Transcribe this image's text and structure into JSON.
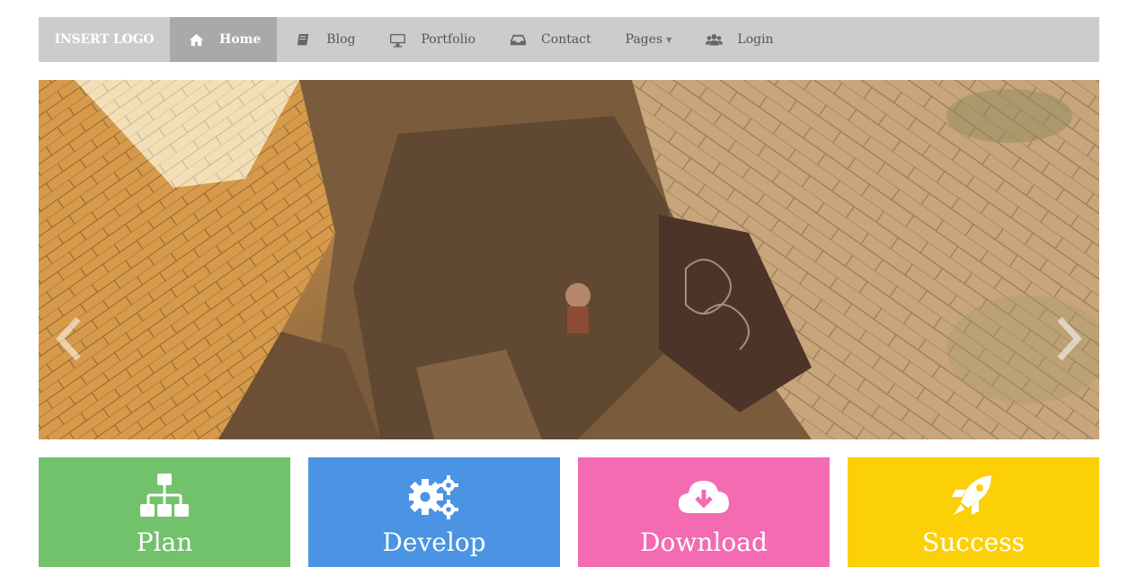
{
  "navbar": {
    "brand": "INSERT LOGO",
    "items": [
      {
        "label": "Home",
        "icon": "home-icon",
        "active": true
      },
      {
        "label": "Blog",
        "icon": "book-icon"
      },
      {
        "label": "Portfolio",
        "icon": "desktop-icon"
      },
      {
        "label": "Contact",
        "icon": "inbox-icon"
      },
      {
        "label": "Pages",
        "icon": "caret-down-icon"
      },
      {
        "label": "Login",
        "icon": "users-icon"
      }
    ]
  },
  "slider": {
    "image": "illustrated-stone-alley-scene",
    "prev_icon": "chevron-left-icon",
    "next_icon": "chevron-right-icon"
  },
  "tiles": [
    {
      "label": "Plan",
      "icon": "sitemap-icon",
      "color": "#72c16b"
    },
    {
      "label": "Develop",
      "icon": "gears-icon",
      "color": "#4a94e3"
    },
    {
      "label": "Download",
      "icon": "cloud-download-icon",
      "color": "#f46bb2"
    },
    {
      "label": "Success",
      "icon": "rocket-icon",
      "color": "#fcd006"
    }
  ]
}
